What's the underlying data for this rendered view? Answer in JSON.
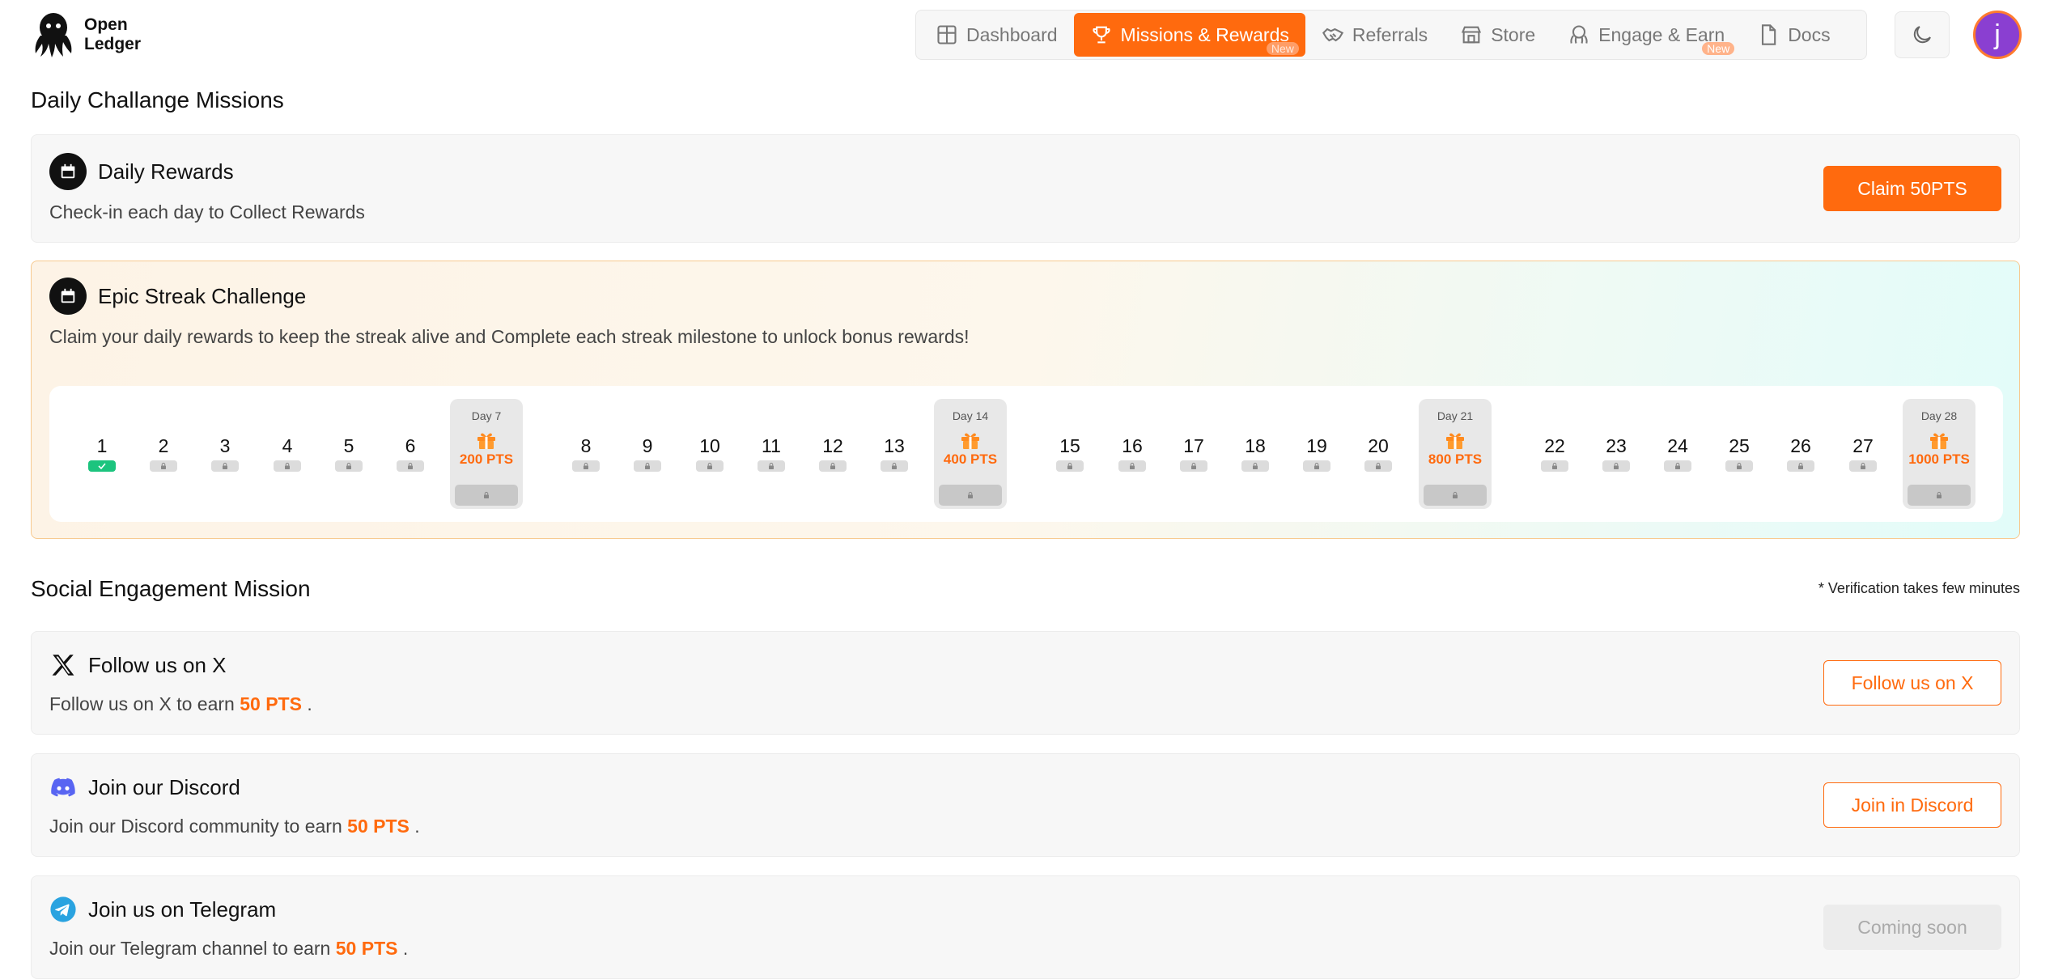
{
  "header": {
    "logo_line1": "Open",
    "logo_line2": "Ledger",
    "nav": [
      {
        "label": "Dashboard",
        "icon": "grid-icon"
      },
      {
        "label": "Missions & Rewards",
        "icon": "trophy-icon",
        "active": true,
        "badge": "New"
      },
      {
        "label": "Referrals",
        "icon": "handshake-icon"
      },
      {
        "label": "Store",
        "icon": "store-icon"
      },
      {
        "label": "Engage & Earn",
        "icon": "octopus-icon",
        "badge": "New"
      },
      {
        "label": "Docs",
        "icon": "document-icon"
      }
    ],
    "theme_icon": "moon-icon",
    "avatar_letter": "j",
    "accent_color": "#ff6a0e"
  },
  "daily": {
    "section_title": "Daily Challange Missions",
    "rewards_title": "Daily Rewards",
    "rewards_desc": "Check-in each day to Collect Rewards",
    "claim_label": "Claim 50PTS"
  },
  "streak": {
    "title": "Epic Streak Challenge",
    "desc": "Claim your daily rewards to keep the streak alive and Complete each streak milestone to unlock bonus rewards!",
    "days": [
      "1",
      "2",
      "3",
      "4",
      "5",
      "6",
      "8",
      "9",
      "10",
      "11",
      "12",
      "13",
      "15",
      "16",
      "17",
      "18",
      "19",
      "20",
      "22",
      "23",
      "24",
      "25",
      "26",
      "27"
    ],
    "completed_days": [
      "1"
    ],
    "milestones": [
      {
        "label": "Day 7",
        "pts": "200 PTS"
      },
      {
        "label": "Day 14",
        "pts": "400 PTS"
      },
      {
        "label": "Day 21",
        "pts": "800 PTS"
      },
      {
        "label": "Day 28",
        "pts": "1000 PTS"
      }
    ]
  },
  "social": {
    "section_title": "Social Engagement Mission",
    "note": "* Verification takes few minutes",
    "x": {
      "title": "Follow us on X",
      "desc_pre": "Follow us on X to earn",
      "pts": "50 PTS",
      "desc_post": ".",
      "button": "Follow us on X"
    },
    "discord": {
      "title": "Join our Discord",
      "desc_pre": "Join our Discord community to earn",
      "pts": "50 PTS",
      "desc_post": ".",
      "button": "Join in Discord"
    },
    "telegram": {
      "title": "Join us on Telegram",
      "desc_pre": "Join our Telegram channel to earn",
      "pts": "50 PTS",
      "desc_post": ".",
      "button": "Coming soon"
    }
  }
}
